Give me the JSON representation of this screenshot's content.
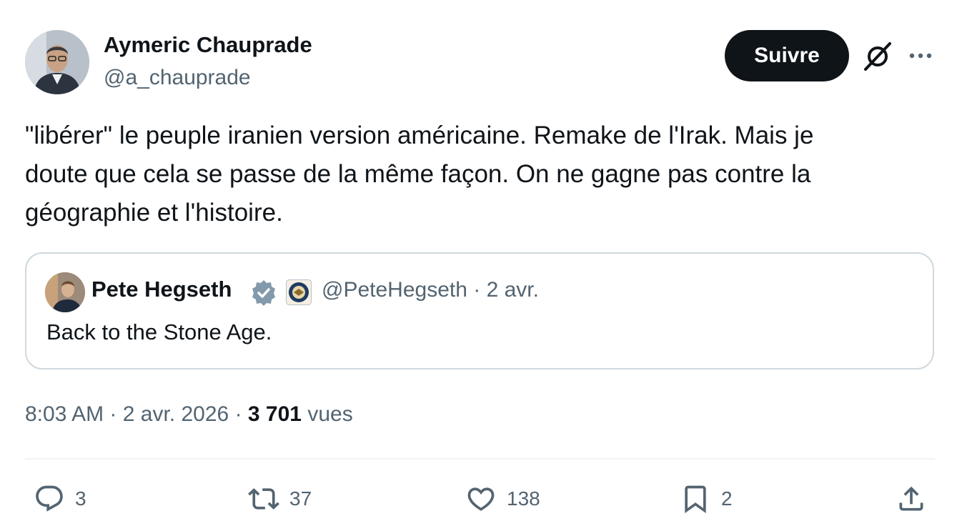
{
  "author": {
    "name": "Aymeric Chauprade",
    "handle": "@a_chauprade"
  },
  "actions_top": {
    "follow_label": "Suivre",
    "grok_icon": "grok-icon",
    "more_icon": "more-icon"
  },
  "tweet": {
    "text": "\"libérer\" le peuple iranien version américaine. Remake de l'Irak. Mais je\ndoute que cela se passe de la même façon. On ne gagne pas contre la\ngéographie et l'histoire."
  },
  "quote": {
    "name": "Pete Hegseth",
    "handle": "@PeteHegseth",
    "separator": "·",
    "date": "2 avr.",
    "text": "Back to the Stone Age.",
    "verified_color": "#829aab"
  },
  "meta": {
    "time": "8:03 AM",
    "date": "2 avr. 2026",
    "views_count": "3 701",
    "views_label": "vues"
  },
  "stats": {
    "replies": "3",
    "reposts": "37",
    "likes": "138",
    "bookmarks": "2"
  },
  "colors": {
    "text": "#0f1419",
    "secondary": "#536471",
    "button_bg": "#0f1419",
    "border": "#cfd9de"
  }
}
